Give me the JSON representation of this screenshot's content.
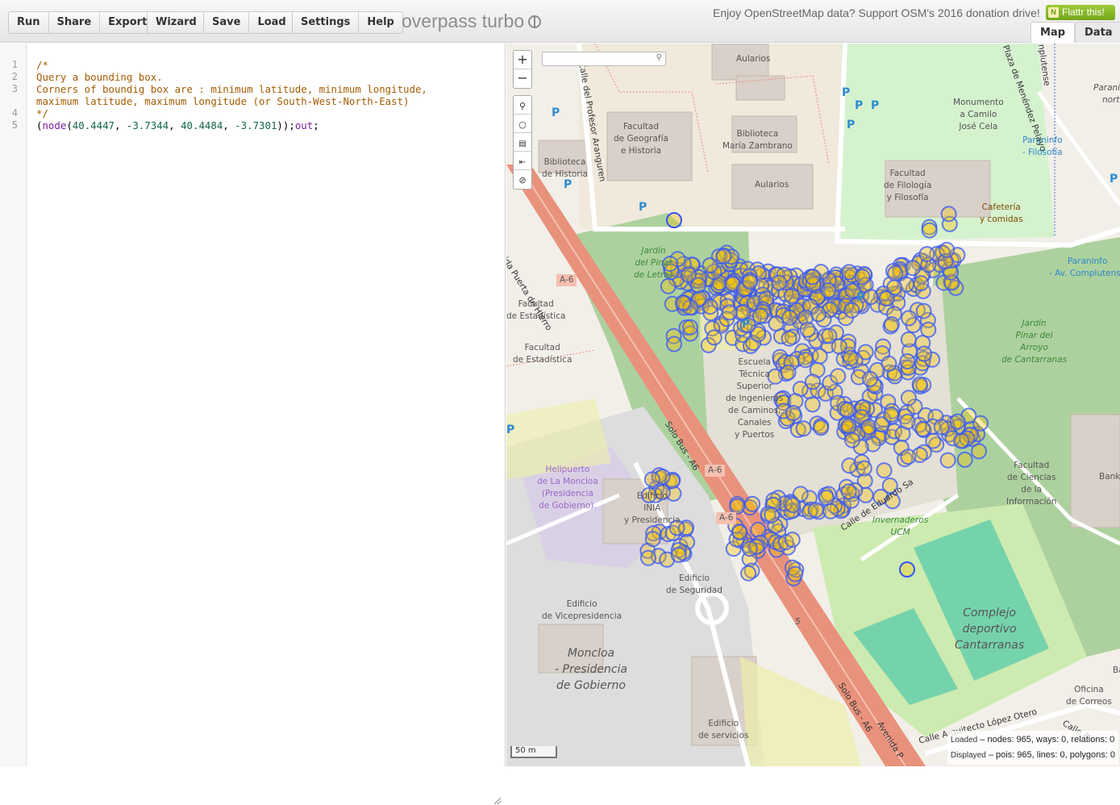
{
  "toolbar": {
    "run": "Run",
    "share": "Share",
    "export": "Export",
    "wizard": "Wizard",
    "save": "Save",
    "load": "Load",
    "settings": "Settings",
    "help": "Help"
  },
  "brand": "overpass turbo",
  "donation": "Enjoy OpenStreetMap data? Support OSM's 2016 donation drive!",
  "flattr": "Flattr this!",
  "tabs": {
    "map": "Map",
    "data": "Data"
  },
  "editor": {
    "line_numbers": [
      "1",
      "2",
      "3",
      "4",
      "5"
    ],
    "lines": [
      "/*",
      "Query a bounding box.",
      "Corners of boundig box are : minimum latitude, minimum longitude,",
      "maximum latitude, maximum longitude (or South-West-North-East)",
      "*/",
      "(node(40.4447, -3.7344, 40.4484, -3.7301));out;"
    ]
  },
  "map": {
    "zoom_in": "+",
    "zoom_out": "−",
    "scale": "50 m",
    "labels": {
      "aularios_1": "Aularios",
      "aularios_2": "Aularios",
      "geografia": "Facultad\nde Geografía\ne Historia",
      "biblioteca_historia": "Biblioteca\nde Historia",
      "biblioteca_zambrano": "Biblioteca\nMaría Zambrano",
      "monumento": "Monumento\na Camilo\nJosé Cela",
      "filologia": "Facultad\nde Filología\ny Filosofía",
      "cafeteria": "Cafetería\ny comidas",
      "paraninfo_filosofia": "Paraninfo\n- Filosofía",
      "paraninfo_av": "Paraninfo\n- Av. Complutense",
      "paraninfo_norte": "Paraninfo\nnorte",
      "jardin_pinar": "Jardín\ndel Pinar\nde Letras",
      "jardin_arroyo": "Jardín\nPinar del\nArroyo\nde Cantarranas",
      "estadistica_1": "Facultad\nde Estadística",
      "estadistica_2": "Facultad\nde Estadística",
      "caminos": "Escuela\nTécnica\nSuperior\nde Ingenieros\nde Caminos,\nCanales\ny Puertos",
      "helipuerto": "Helipuerto\nde La Moncloa\n(Presidencia\nde Gobierno).",
      "edificio_inia": "Edificio\nINIA\ny Presidencia",
      "edificio_seguridad": "Edificio\nde Seguridad",
      "vicepresidencia": "Edificio\nde Vicepresidencia",
      "moncloa": "Moncloa\n- Presidencia\nde Gobierno",
      "servicios": "Edificio\nde servicios",
      "ciencias_info": "Facultad\nde Ciencias\nde la\nInformación",
      "invernaderos": "Invernaderos\nUCM",
      "complejo": "Complejo\ndeportivo\nCantarranas",
      "oficina_correos": "Oficina\nde Correos",
      "bank": "Banki",
      "bank2": "Bank",
      "road_a6_1": "A-6",
      "road_a6_2": "A-6",
      "road_a6_3": "A-6",
      "avenida_puerta": "Avenida Puerta de Hierro",
      "solo_bus": "Solo Bus - A6",
      "solo_bus_2": "Solo Bus - A6",
      "avenida_p": "Avenida P",
      "eduardo": "Calle de Eduardo Sa",
      "arquitecto": "Calle Arquitecto López Otero",
      "calle": "Calle A",
      "aranguren": "Calle del Profesor Aranguren",
      "menendez": "Plaza de Menéndez Pelayo",
      "complutense": "nplutense",
      "road_5": "5"
    }
  },
  "stats": {
    "loaded_label": "Loaded",
    "loaded_value": "– nodes: 965, ways: 0, relations: 0",
    "displayed_label": "Displayed",
    "displayed_value": "– pois: 965, lines: 0, polygons: 0"
  },
  "colors": {
    "marker_fill": "#f5c400",
    "marker_stroke": "#3355ff",
    "motorway": "#f0a08a",
    "grass": "#cfe8bd",
    "forest": "#add19e",
    "campus": "#e8e2d0"
  }
}
